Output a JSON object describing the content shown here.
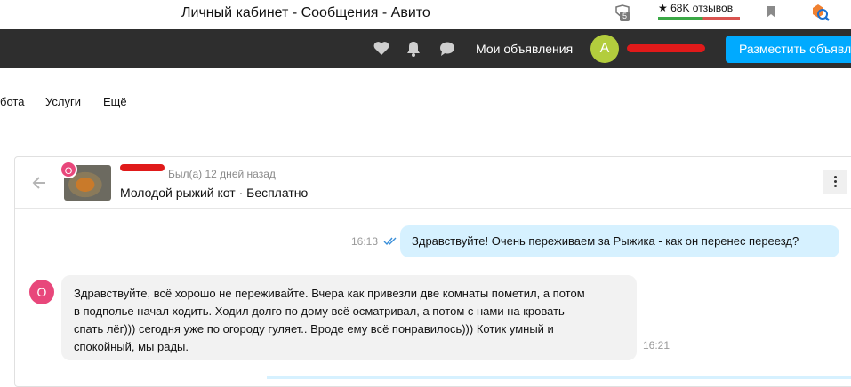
{
  "window": {
    "title": "Личный кабинет - Сообщения - Авито"
  },
  "toolbar": {
    "ext_badge": "5",
    "reviews": "★ 68K отзывов"
  },
  "nav": {
    "my_ads": "Мои объявления",
    "avatar_letter": "А",
    "post_ad": "Разместить объявл"
  },
  "subnav": {
    "items": [
      "бота",
      "Услуги",
      "Ещё"
    ]
  },
  "chat": {
    "user_initial": "О",
    "last_seen": "Был(а) 12 дней назад",
    "item_title": "Молодой рыжий кот · Бесплатно",
    "messages": [
      {
        "direction": "out",
        "time": "16:13",
        "text": "Здравствуйте! Очень переживаем за Рыжика - как он перенес переезд?"
      },
      {
        "direction": "in",
        "time": "16:21",
        "line1": "Здравствуйте, всё хорошо не переживайте. Вчера как привезли две комнаты пометил, а потом",
        "line2": "в подполье начал ходить. Ходил долго по дому всё осматривал, а потом с нами на кровать",
        "line3": "спать лёг))) сегодня уже по огороду гуляет.. Вроде ему всё понравилось)))  Котик  умный и",
        "line4": "спокойный, мы рады."
      }
    ]
  },
  "colors": {
    "accent": "#00aaff",
    "nav_bg": "#2e2e2e",
    "bubble_out": "#d6f1ff",
    "bubble_in": "#f2f2f2",
    "avatar_pink": "#e8477b",
    "avatar_green": "#b3cd3d"
  }
}
